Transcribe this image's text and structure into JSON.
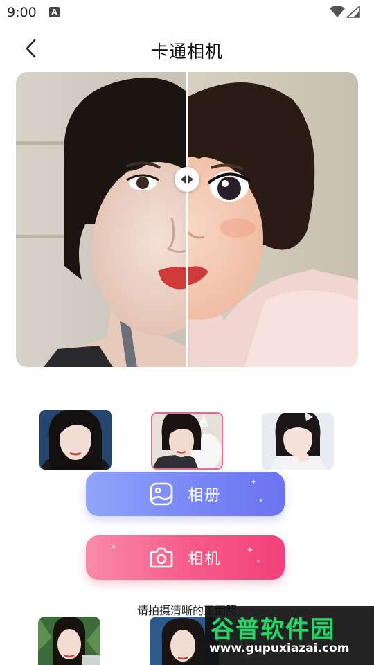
{
  "status_bar": {
    "time": "9:00",
    "notification_icon": "A"
  },
  "header": {
    "title": "卡通相机"
  },
  "buttons": {
    "album_label": "相册",
    "camera_label": "相机"
  },
  "hint": {
    "text": "请拍摄清晰的正面照"
  },
  "watermark": {
    "logo": "谷普软件园",
    "url": "www.gupuxiazai.com"
  },
  "colors": {
    "album_accent": "#7a86f5",
    "camera_accent": "#f6598a",
    "selected_border": "#f06892"
  },
  "icons": [
    "back-arrow-icon",
    "wifi-icon",
    "signal-icon",
    "split-arrows-icon",
    "gallery-icon",
    "camera-icon"
  ]
}
